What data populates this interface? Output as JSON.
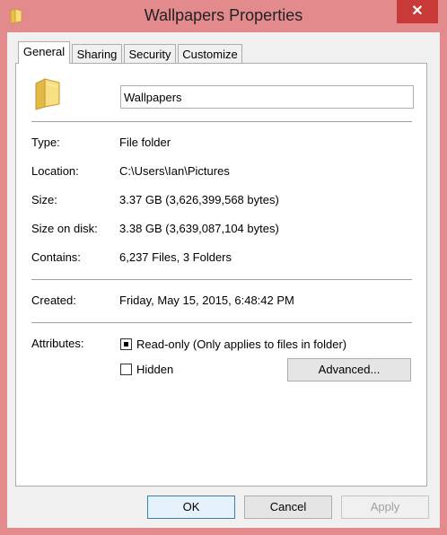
{
  "window": {
    "title": "Wallpapers Properties",
    "close_label": "✕"
  },
  "tabs": [
    {
      "label": "General"
    },
    {
      "label": "Sharing"
    },
    {
      "label": "Security"
    },
    {
      "label": "Customize"
    }
  ],
  "general": {
    "folder_name": "Wallpapers",
    "rows": [
      {
        "label": "Type:",
        "value": "File folder"
      },
      {
        "label": "Location:",
        "value": "C:\\Users\\Ian\\Pictures"
      },
      {
        "label": "Size:",
        "value": "3.37 GB (3,626,399,568 bytes)"
      },
      {
        "label": "Size on disk:",
        "value": "3.38 GB (3,639,087,104 bytes)"
      },
      {
        "label": "Contains:",
        "value": "6,237 Files, 3 Folders"
      }
    ],
    "created": {
      "label": "Created:",
      "value": "Friday, May 15, 2015, 6:48:42 PM"
    },
    "attributes": {
      "label": "Attributes:",
      "readonly_label": "Read-only (Only applies to files in folder)",
      "readonly_state": "indeterminate",
      "hidden_label": "Hidden",
      "hidden_state": "unchecked",
      "advanced_label": "Advanced..."
    }
  },
  "buttons": {
    "ok": "OK",
    "cancel": "Cancel",
    "apply": "Apply"
  },
  "colors": {
    "window_frame": "#e38a8d",
    "close_button": "#c83a37",
    "folder_yellow": "#f3d56b"
  }
}
